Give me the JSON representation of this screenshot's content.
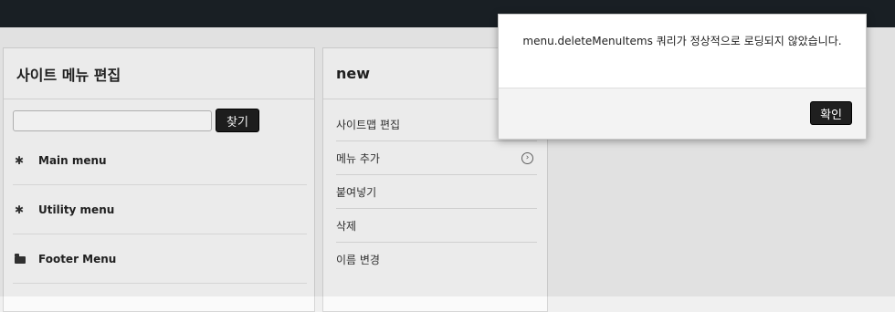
{
  "left_panel": {
    "title": "사이트 메뉴 편집",
    "search": {
      "value": "",
      "placeholder": "",
      "button_label": "찾기"
    },
    "menus": [
      {
        "label": "Main menu",
        "icon": "asterisk-icon"
      },
      {
        "label": "Utility menu",
        "icon": "asterisk-icon"
      },
      {
        "label": "Footer Menu",
        "icon": "folder-icon"
      }
    ]
  },
  "mid_panel": {
    "title": "new",
    "items": [
      {
        "label": "사이트맵 편집"
      },
      {
        "label": "메뉴 추가",
        "has_chevron": true
      },
      {
        "label": "붙여넣기"
      },
      {
        "label": "삭제"
      },
      {
        "label": "이름 변경"
      }
    ]
  },
  "dialog": {
    "message": "menu.deleteMenuItems 쿼리가 정상적으로 로딩되지 않았습니다.",
    "ok_label": "확인"
  },
  "colors": {
    "topbar": "#1b2127",
    "button_bg": "#1f1f1f",
    "page_bg": "#f0f0f0"
  }
}
